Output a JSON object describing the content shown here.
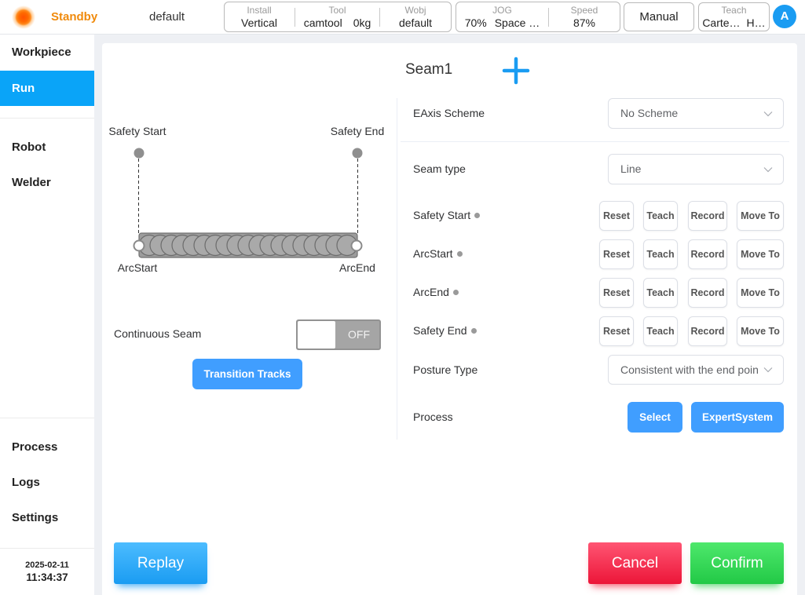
{
  "colors": {
    "accent": "#1a9cf2",
    "sidebar_active": "#0aa4f8",
    "status_standby": "#f08a0c",
    "primary_button": "#409eff",
    "cancel": "#ec1538",
    "confirm": "#22c946",
    "point_status": "#9a9a9a"
  },
  "topbar": {
    "status_icon": "status-orb-icon",
    "state": "Standby",
    "program": "default",
    "install": {
      "label": "Install",
      "value": "Vertical"
    },
    "tool": {
      "label": "Tool",
      "values": [
        "camtool",
        "0kg"
      ]
    },
    "wobj": {
      "label": "Wobj",
      "value": "default"
    },
    "jog": {
      "label": "JOG",
      "values": [
        "70%",
        "Space …"
      ]
    },
    "speed": {
      "label": "Speed",
      "value": "87%"
    },
    "mode_button": "Manual",
    "teach": {
      "label": "Teach",
      "values": [
        "Carte…",
        "H…"
      ]
    },
    "avatar": "A"
  },
  "sidebar": {
    "items_top": [
      {
        "label": "Workpiece",
        "active": false
      },
      {
        "label": "Run",
        "active": true
      }
    ],
    "items_mid": [
      {
        "label": "Robot",
        "active": false
      },
      {
        "label": "Welder",
        "active": false
      }
    ],
    "items_bottom": [
      {
        "label": "Process",
        "active": false
      },
      {
        "label": "Logs",
        "active": false
      },
      {
        "label": "Settings",
        "active": false
      }
    ],
    "date": "2025-02-11",
    "time": "11:34:37"
  },
  "seam": {
    "title": "Seam1",
    "add_icon": "plus-icon",
    "diagram": {
      "safety_start": "Safety Start",
      "safety_end": "Safety End",
      "arc_start": "ArcStart",
      "arc_end": "ArcEnd"
    },
    "continuous": {
      "label": "Continuous Seam",
      "state": "OFF",
      "enabled": false
    },
    "transition_button": "Transition Tracks",
    "form": {
      "select_icon": "chevron-down-icon",
      "eaxis": {
        "label": "EAxis Scheme",
        "value": "No Scheme"
      },
      "seam_type": {
        "label": "Seam type",
        "value": "Line"
      },
      "points": [
        {
          "label": "Safety Start",
          "actions": [
            "Reset",
            "Teach",
            "Record",
            "Move To"
          ]
        },
        {
          "label": "ArcStart",
          "actions": [
            "Reset",
            "Teach",
            "Record",
            "Move To"
          ]
        },
        {
          "label": "ArcEnd",
          "actions": [
            "Reset",
            "Teach",
            "Record",
            "Move To"
          ]
        },
        {
          "label": "Safety End",
          "actions": [
            "Reset",
            "Teach",
            "Record",
            "Move To"
          ]
        }
      ],
      "posture": {
        "label": "Posture Type",
        "value": "Consistent with the end poin"
      },
      "process": {
        "label": "Process",
        "select_button": "Select",
        "expert_button": "ExpertSystem"
      }
    }
  },
  "footer": {
    "replay": "Replay",
    "cancel": "Cancel",
    "confirm": "Confirm"
  }
}
